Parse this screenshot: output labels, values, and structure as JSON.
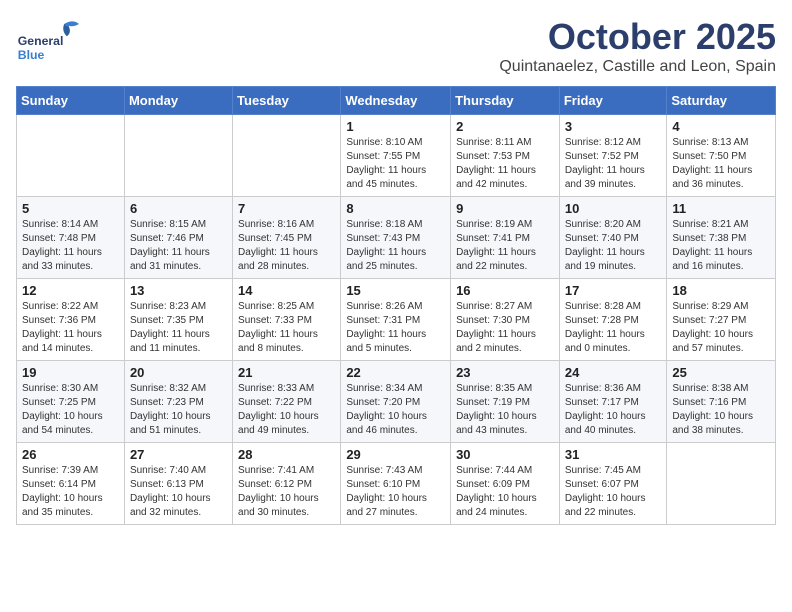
{
  "header": {
    "logo_line1": "General",
    "logo_line2": "Blue",
    "month": "October 2025",
    "location": "Quintanaelez, Castille and Leon, Spain"
  },
  "columns": [
    "Sunday",
    "Monday",
    "Tuesday",
    "Wednesday",
    "Thursday",
    "Friday",
    "Saturday"
  ],
  "weeks": [
    [
      {
        "day": "",
        "info": ""
      },
      {
        "day": "",
        "info": ""
      },
      {
        "day": "",
        "info": ""
      },
      {
        "day": "1",
        "info": "Sunrise: 8:10 AM\nSunset: 7:55 PM\nDaylight: 11 hours and 45 minutes."
      },
      {
        "day": "2",
        "info": "Sunrise: 8:11 AM\nSunset: 7:53 PM\nDaylight: 11 hours and 42 minutes."
      },
      {
        "day": "3",
        "info": "Sunrise: 8:12 AM\nSunset: 7:52 PM\nDaylight: 11 hours and 39 minutes."
      },
      {
        "day": "4",
        "info": "Sunrise: 8:13 AM\nSunset: 7:50 PM\nDaylight: 11 hours and 36 minutes."
      }
    ],
    [
      {
        "day": "5",
        "info": "Sunrise: 8:14 AM\nSunset: 7:48 PM\nDaylight: 11 hours and 33 minutes."
      },
      {
        "day": "6",
        "info": "Sunrise: 8:15 AM\nSunset: 7:46 PM\nDaylight: 11 hours and 31 minutes."
      },
      {
        "day": "7",
        "info": "Sunrise: 8:16 AM\nSunset: 7:45 PM\nDaylight: 11 hours and 28 minutes."
      },
      {
        "day": "8",
        "info": "Sunrise: 8:18 AM\nSunset: 7:43 PM\nDaylight: 11 hours and 25 minutes."
      },
      {
        "day": "9",
        "info": "Sunrise: 8:19 AM\nSunset: 7:41 PM\nDaylight: 11 hours and 22 minutes."
      },
      {
        "day": "10",
        "info": "Sunrise: 8:20 AM\nSunset: 7:40 PM\nDaylight: 11 hours and 19 minutes."
      },
      {
        "day": "11",
        "info": "Sunrise: 8:21 AM\nSunset: 7:38 PM\nDaylight: 11 hours and 16 minutes."
      }
    ],
    [
      {
        "day": "12",
        "info": "Sunrise: 8:22 AM\nSunset: 7:36 PM\nDaylight: 11 hours and 14 minutes."
      },
      {
        "day": "13",
        "info": "Sunrise: 8:23 AM\nSunset: 7:35 PM\nDaylight: 11 hours and 11 minutes."
      },
      {
        "day": "14",
        "info": "Sunrise: 8:25 AM\nSunset: 7:33 PM\nDaylight: 11 hours and 8 minutes."
      },
      {
        "day": "15",
        "info": "Sunrise: 8:26 AM\nSunset: 7:31 PM\nDaylight: 11 hours and 5 minutes."
      },
      {
        "day": "16",
        "info": "Sunrise: 8:27 AM\nSunset: 7:30 PM\nDaylight: 11 hours and 2 minutes."
      },
      {
        "day": "17",
        "info": "Sunrise: 8:28 AM\nSunset: 7:28 PM\nDaylight: 11 hours and 0 minutes."
      },
      {
        "day": "18",
        "info": "Sunrise: 8:29 AM\nSunset: 7:27 PM\nDaylight: 10 hours and 57 minutes."
      }
    ],
    [
      {
        "day": "19",
        "info": "Sunrise: 8:30 AM\nSunset: 7:25 PM\nDaylight: 10 hours and 54 minutes."
      },
      {
        "day": "20",
        "info": "Sunrise: 8:32 AM\nSunset: 7:23 PM\nDaylight: 10 hours and 51 minutes."
      },
      {
        "day": "21",
        "info": "Sunrise: 8:33 AM\nSunset: 7:22 PM\nDaylight: 10 hours and 49 minutes."
      },
      {
        "day": "22",
        "info": "Sunrise: 8:34 AM\nSunset: 7:20 PM\nDaylight: 10 hours and 46 minutes."
      },
      {
        "day": "23",
        "info": "Sunrise: 8:35 AM\nSunset: 7:19 PM\nDaylight: 10 hours and 43 minutes."
      },
      {
        "day": "24",
        "info": "Sunrise: 8:36 AM\nSunset: 7:17 PM\nDaylight: 10 hours and 40 minutes."
      },
      {
        "day": "25",
        "info": "Sunrise: 8:38 AM\nSunset: 7:16 PM\nDaylight: 10 hours and 38 minutes."
      }
    ],
    [
      {
        "day": "26",
        "info": "Sunrise: 7:39 AM\nSunset: 6:14 PM\nDaylight: 10 hours and 35 minutes."
      },
      {
        "day": "27",
        "info": "Sunrise: 7:40 AM\nSunset: 6:13 PM\nDaylight: 10 hours and 32 minutes."
      },
      {
        "day": "28",
        "info": "Sunrise: 7:41 AM\nSunset: 6:12 PM\nDaylight: 10 hours and 30 minutes."
      },
      {
        "day": "29",
        "info": "Sunrise: 7:43 AM\nSunset: 6:10 PM\nDaylight: 10 hours and 27 minutes."
      },
      {
        "day": "30",
        "info": "Sunrise: 7:44 AM\nSunset: 6:09 PM\nDaylight: 10 hours and 24 minutes."
      },
      {
        "day": "31",
        "info": "Sunrise: 7:45 AM\nSunset: 6:07 PM\nDaylight: 10 hours and 22 minutes."
      },
      {
        "day": "",
        "info": ""
      }
    ]
  ]
}
